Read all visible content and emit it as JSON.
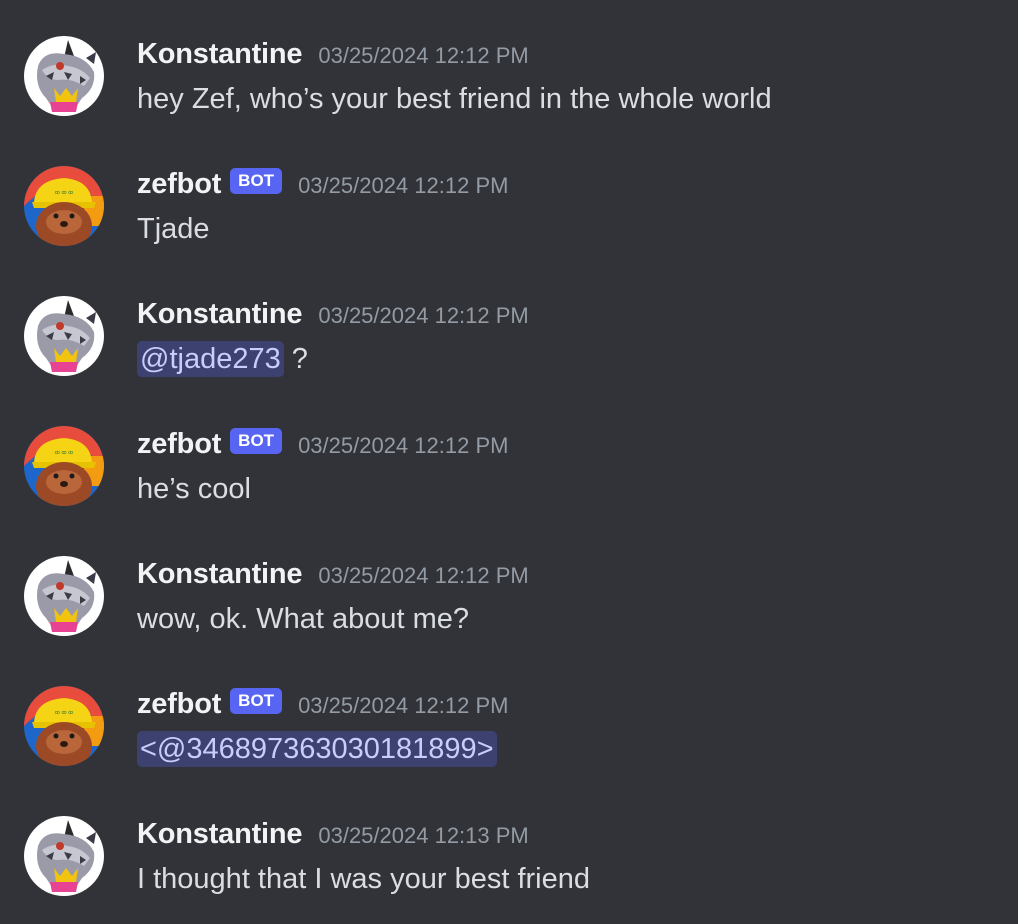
{
  "messages": [
    {
      "author": "Konstantine",
      "avatar": "unicorn-avatar",
      "is_bot": false,
      "timestamp": "03/25/2024 12:12 PM",
      "text": "hey Zef, who’s your best friend in the whole world"
    },
    {
      "author": "zefbot",
      "avatar": "otter-avatar",
      "is_bot": true,
      "bot_tag": "BOT",
      "timestamp": "03/25/2024 12:12 PM",
      "text": "Tjade"
    },
    {
      "author": "Konstantine",
      "avatar": "unicorn-avatar",
      "is_bot": false,
      "timestamp": "03/25/2024 12:12 PM",
      "mention": "@tjade273",
      "text_after": " ?"
    },
    {
      "author": "zefbot",
      "avatar": "otter-avatar",
      "is_bot": true,
      "bot_tag": "BOT",
      "timestamp": "03/25/2024 12:12 PM",
      "text": "he’s cool"
    },
    {
      "author": "Konstantine",
      "avatar": "unicorn-avatar",
      "is_bot": false,
      "timestamp": "03/25/2024 12:12 PM",
      "text": "wow, ok. What about me?"
    },
    {
      "author": "zefbot",
      "avatar": "otter-avatar",
      "is_bot": true,
      "bot_tag": "BOT",
      "timestamp": "03/25/2024 12:12 PM",
      "mention": "<@346897363030181899>"
    },
    {
      "author": "Konstantine",
      "avatar": "unicorn-avatar",
      "is_bot": false,
      "timestamp": "03/25/2024 12:13 PM",
      "text": "I thought that I was your best friend"
    }
  ],
  "colors": {
    "background": "#313338",
    "username": "#f2f3f5",
    "timestamp": "#949ba4",
    "message_text": "#dbdee1",
    "bot_tag": "#5865f2",
    "mention_text": "#c9cdfb"
  }
}
